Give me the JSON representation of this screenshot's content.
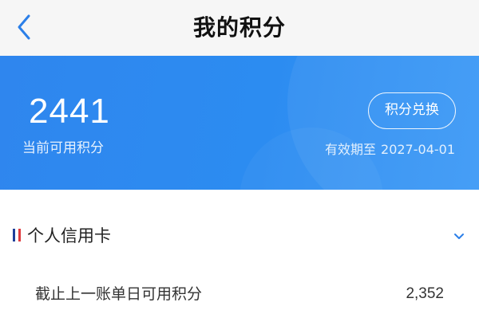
{
  "header": {
    "title": "我的积分",
    "back_icon": "chevron-left-icon"
  },
  "points_card": {
    "value": "2441",
    "label": "当前可用积分",
    "redeem_label": "积分兑换",
    "expiry_label": "有效期至",
    "expiry_date": "2027-04-01",
    "accent_color": "#2f86ee"
  },
  "section": {
    "title": "个人信用卡",
    "flag_icon": "flag-icon",
    "expand_icon": "chevron-down-icon",
    "flag_colors": [
      "#1f3f99",
      "#ffffff",
      "#e03a3e"
    ],
    "rows": [
      {
        "label": "截止上一账单日可用积分",
        "value": "2,352"
      }
    ]
  }
}
